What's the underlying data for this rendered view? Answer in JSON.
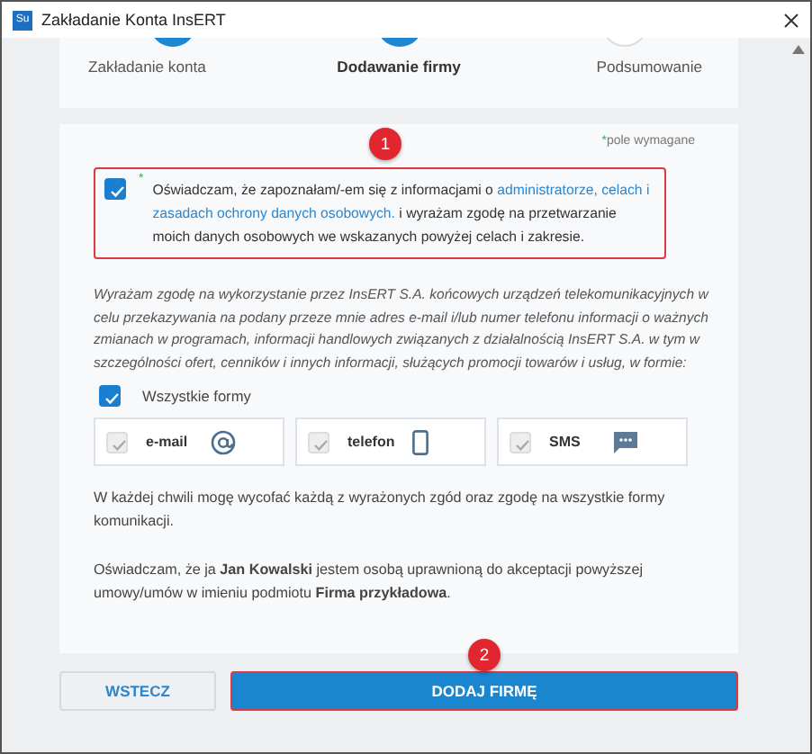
{
  "window": {
    "title": "Zakładanie Konta InsERT",
    "app_icon": "Su"
  },
  "steps": [
    {
      "label": "Zakładanie konta",
      "completed": true,
      "selected": false
    },
    {
      "label": "Dodawanie firmy",
      "completed": false,
      "selected": true
    },
    {
      "label": "Podsumowanie",
      "completed": false,
      "selected": false
    }
  ],
  "required_note": {
    "mark": "*",
    "text": "pole wymagane"
  },
  "callouts": [
    "1",
    "2"
  ],
  "consent": {
    "checked": true,
    "highlighted": true,
    "mark": "*",
    "text_before": "Oświadczam, że zapoznałam/-em się z informacjami o ",
    "link_lines": [
      "administratorze, celach i",
      "zasadach ochrony danych osobowych."
    ],
    "text_after": " i wyrażam zgodę na przetwarzanie moich danych osobowych we wskazanych powyżej celach i zakresie."
  },
  "marketing_text": "Wyrażam zgodę na wykorzystanie przez InsERT S.A. końcowych urządzeń telekomunikacyjnych w celu przekazywania na podany przeze mnie adres e-mail i/lub numer telefonu informacji o ważnych zmianach w programach, informacji handlowych związanych z działalnością InsERT S.A. w tym w szczególności ofert, cenników i innych informacji, służących promocji towarów i usług, w formie:",
  "all_forms": {
    "label": "Wszystkie formy",
    "checked": true
  },
  "forms": [
    {
      "label": "e-mail",
      "kind": "email",
      "checked": true,
      "disabled": true
    },
    {
      "label": "telefon",
      "kind": "phone",
      "checked": true,
      "disabled": true
    },
    {
      "label": "SMS",
      "kind": "sms",
      "checked": true,
      "disabled": true
    }
  ],
  "withdraw_text": "W każdej chwili mogę wycofać każdą z wyrażonych zgód oraz zgodę na wszystkie formy komunikacji.",
  "authorization_text": "Oświadczam, że ja **Jan Kowalski** jestem osobą uprawnioną do akceptacji powyższej umowy/umów w imieniu podmiotu **Firma przykładowa**.",
  "buttons": [
    {
      "label": "WSTECZ",
      "kind": "secondary",
      "highlighted": false
    },
    {
      "label": "DODAJ FIRMĘ",
      "kind": "primary",
      "highlighted": true
    }
  ]
}
